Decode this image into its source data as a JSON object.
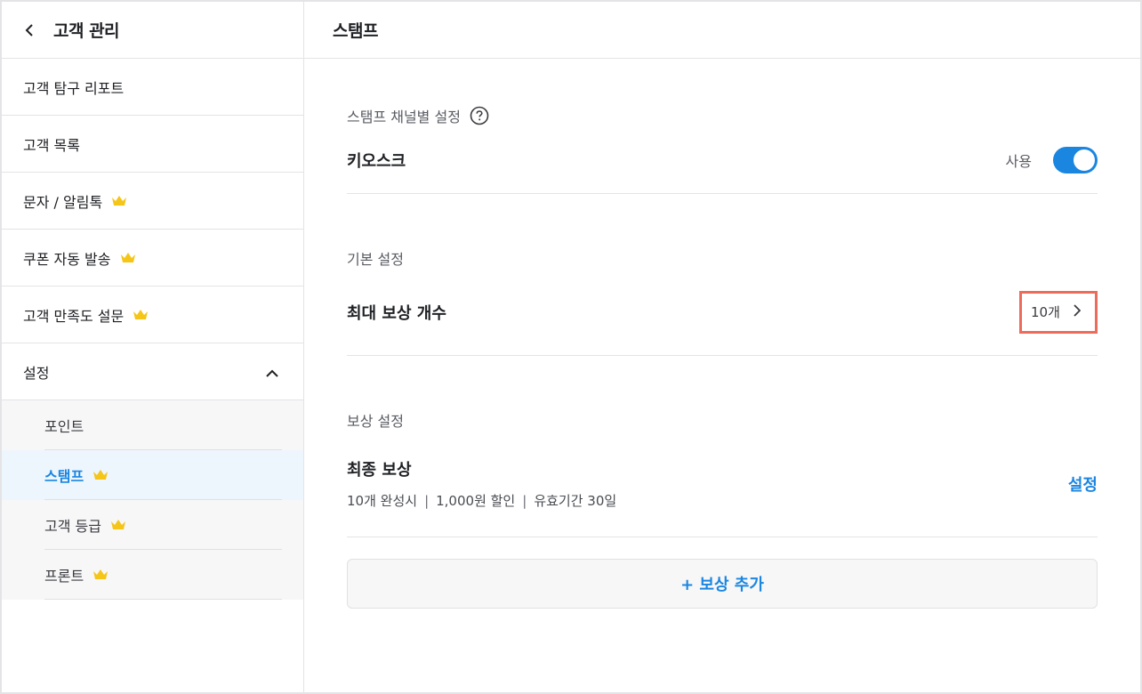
{
  "sidebar": {
    "title": "고객 관리",
    "items": [
      {
        "label": "고객 탐구 리포트",
        "crown": false
      },
      {
        "label": "고객 목록",
        "crown": false
      },
      {
        "label": "문자 / 알림톡",
        "crown": true
      },
      {
        "label": "쿠폰 자동 발송",
        "crown": true
      },
      {
        "label": "고객 만족도 설문",
        "crown": true
      }
    ],
    "settings_label": "설정",
    "subitems": [
      {
        "label": "포인트",
        "crown": false,
        "active": false
      },
      {
        "label": "스탬프",
        "crown": true,
        "active": true
      },
      {
        "label": "고객 등급",
        "crown": true,
        "active": false
      },
      {
        "label": "프론트",
        "crown": true,
        "active": false
      }
    ]
  },
  "main": {
    "title": "스탬프",
    "channel_section": {
      "label": "스탬프 채널별 설정",
      "kiosk_title": "키오스크",
      "toggle_label": "사용",
      "toggle_on": true
    },
    "basic_section": {
      "label": "기본 설정",
      "max_reward_title": "최대 보상 개수",
      "max_reward_value": "10개"
    },
    "reward_section": {
      "label": "보상 설정",
      "final_reward_title": "최종 보상",
      "detail_count": "10개 완성시",
      "detail_discount": "1,000원 할인",
      "detail_validity": "유효기간 30일",
      "separator": "|",
      "setting_label": "설정",
      "add_label": "+ 보상 추가"
    }
  },
  "colors": {
    "accent": "#1b86e0",
    "highlight_border": "#ec6b5a",
    "crown": "#f5c518"
  },
  "icons": [
    "chevron-left-icon",
    "crown-icon",
    "chevron-up-icon",
    "help-circle-icon",
    "chevron-right-icon"
  ]
}
